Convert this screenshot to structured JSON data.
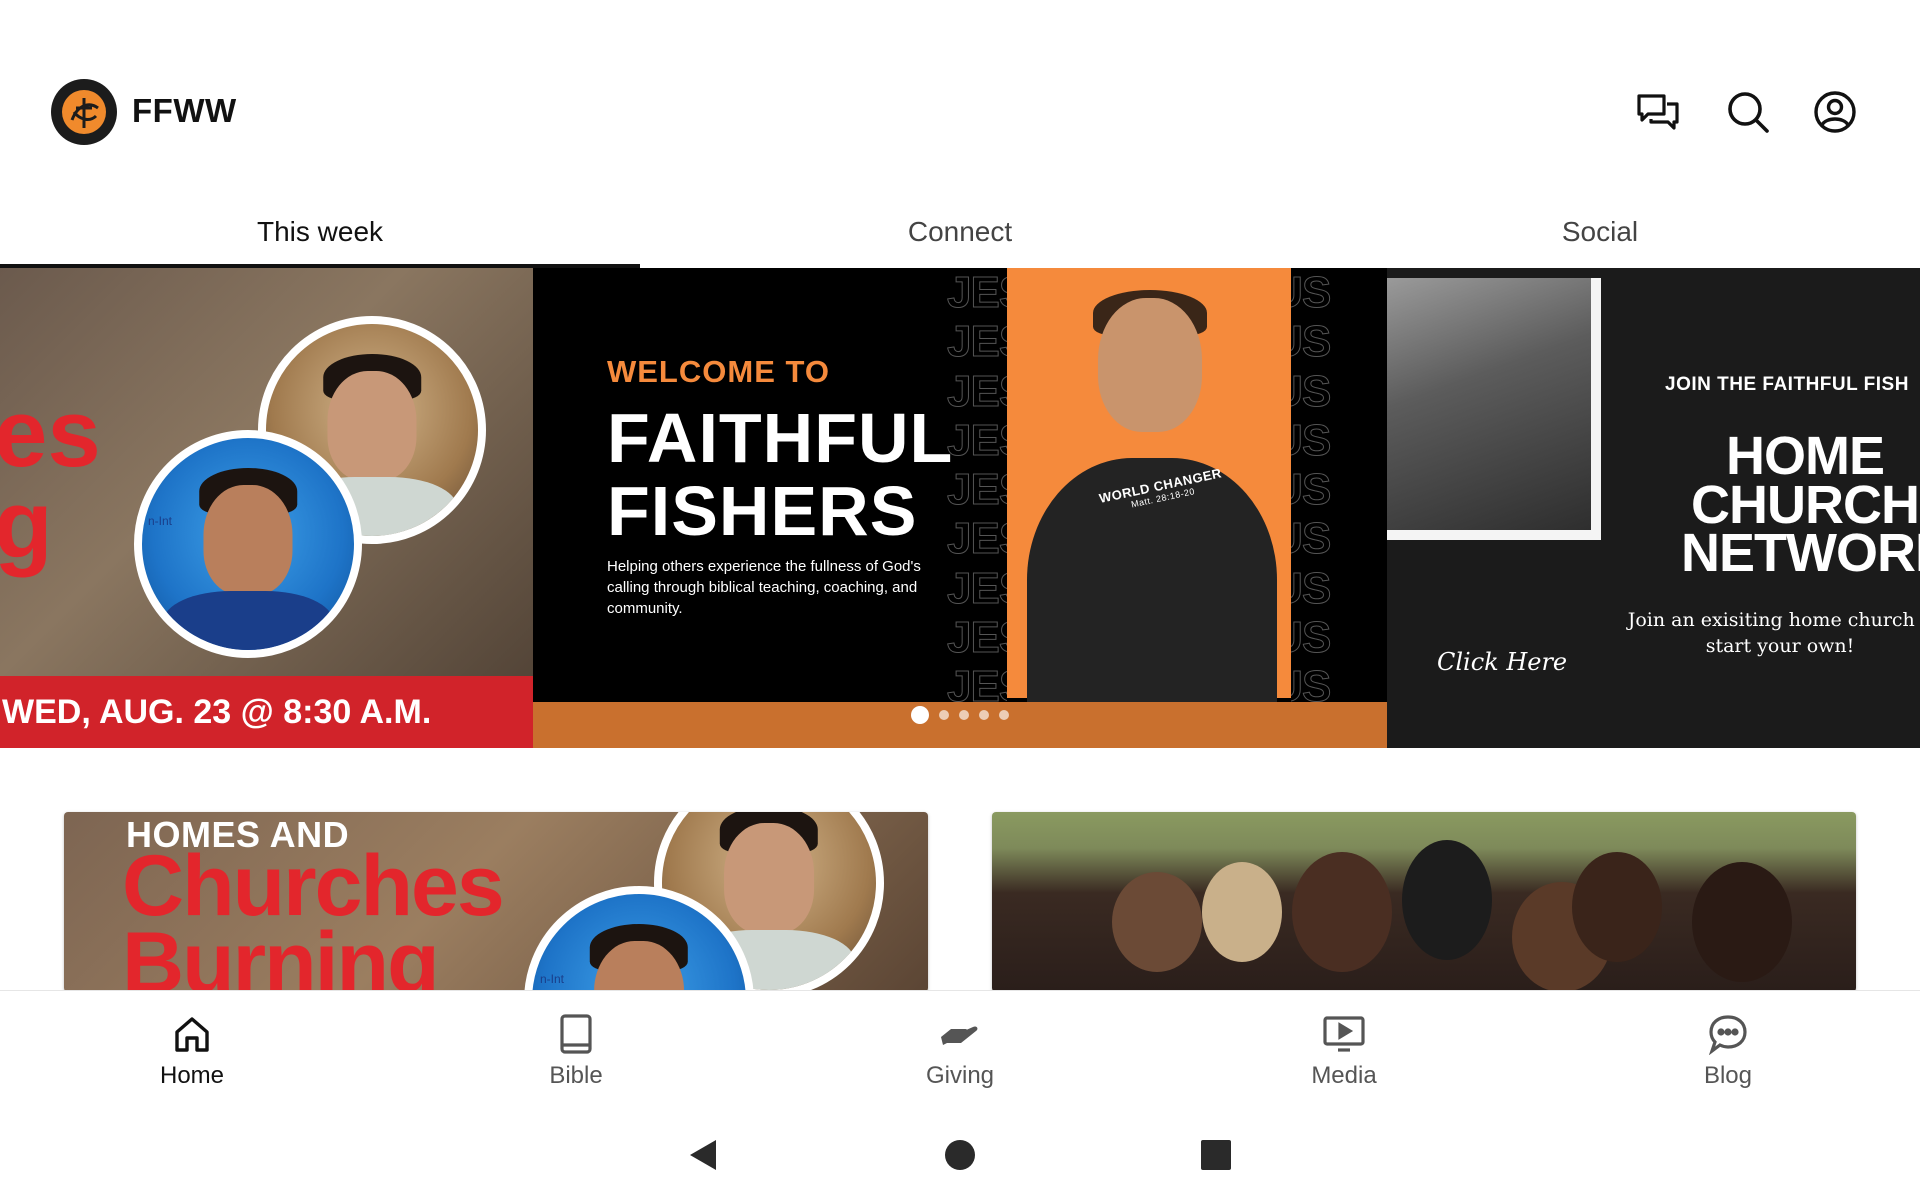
{
  "app": {
    "title": "FFWW",
    "logo_icon": "faithful-fishers-logo",
    "brand_color": "#f08a2c"
  },
  "header_icons": [
    {
      "name": "chat-icon"
    },
    {
      "name": "search-icon"
    },
    {
      "name": "account-icon"
    }
  ],
  "tabs": [
    {
      "label": "This week",
      "active": true
    },
    {
      "label": "Connect",
      "active": false
    },
    {
      "label": "Social",
      "active": false
    }
  ],
  "carousel": {
    "slides": {
      "left": {
        "title_partial": "es\ng",
        "date_text": "WED, AUG. 23 @ 8:30 A.M.",
        "badge_text": "n-Int"
      },
      "center": {
        "welcome": "WELCOME TO",
        "title_line1": "FAITHFUL",
        "title_line2": "FISHERS",
        "description": "Helping others experience the fullness of God's calling through biblical teaching, coaching, and community.",
        "shirt_text": "WORLD CHANGER",
        "shirt_subtext": "Matt. 28:18-20",
        "bg_word": "JESUS",
        "accent_color": "#f58a3c"
      },
      "right": {
        "kicker": "JOIN THE FAITHFUL FISH",
        "title_line1": "HOME",
        "title_line2": "CHURCH",
        "title_line3": "NETWORI",
        "subtitle": "Join an exisiting home church o start your own!",
        "cta": "Click Here"
      }
    },
    "page_count": 5,
    "active_page": 1
  },
  "cards": [
    {
      "name": "homes-and-churches-burning",
      "line1": "HOMES AND",
      "line2": "Churches",
      "line3": "Burning",
      "badge_text": "n-Int"
    },
    {
      "name": "prayer-gathering"
    }
  ],
  "bottom_nav": [
    {
      "label": "Home",
      "icon": "home-icon",
      "active": true
    },
    {
      "label": "Bible",
      "icon": "book-icon",
      "active": false
    },
    {
      "label": "Giving",
      "icon": "giving-hand-icon",
      "active": false
    },
    {
      "label": "Media",
      "icon": "media-play-icon",
      "active": false
    },
    {
      "label": "Blog",
      "icon": "chat-bubble-icon",
      "active": false
    }
  ],
  "system_nav": [
    {
      "name": "back-button"
    },
    {
      "name": "home-button"
    },
    {
      "name": "recents-button"
    }
  ]
}
